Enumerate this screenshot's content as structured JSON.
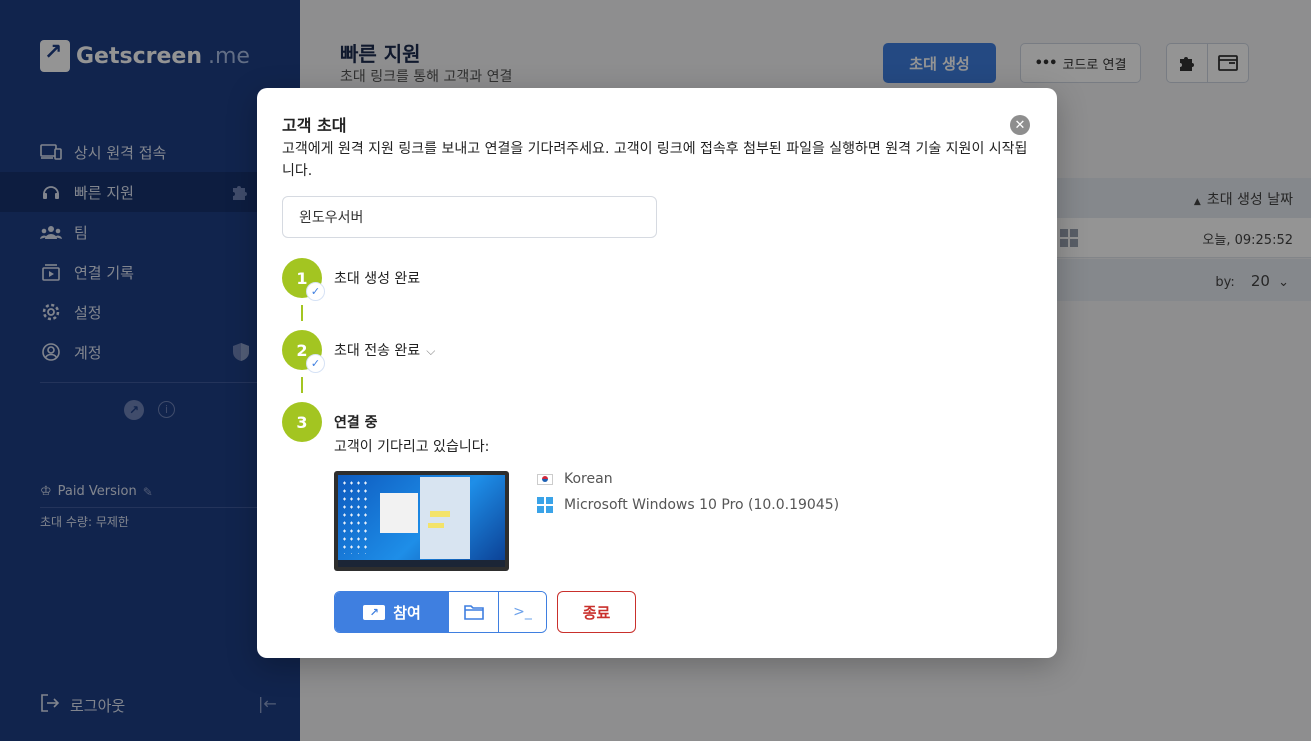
{
  "sidebar": {
    "logo_text": "Getscreen",
    "logo_suffix": ".me",
    "items": [
      {
        "label": "상시 원격 접속",
        "icon": "devices-icon"
      },
      {
        "label": "빠른 지원",
        "icon": "headset-icon",
        "active": true,
        "extra_icon": "puzzle-icon"
      },
      {
        "label": "팀",
        "icon": "team-icon"
      },
      {
        "label": "연결 기록",
        "icon": "history-icon"
      },
      {
        "label": "설정",
        "icon": "gear-icon"
      },
      {
        "label": "계정",
        "icon": "account-icon",
        "extra_icon": "shield-icon"
      }
    ],
    "paid_version": "Paid Version",
    "invite_count": "초대 수량: 무제한",
    "logout": "로그아웃"
  },
  "main": {
    "title": "빠른 지원",
    "subtitle": "초대 링크를 통해 고객과 연결",
    "create_button": "초대 생성",
    "code_connect_button": "코드로 연결",
    "code_dots": "•••",
    "table": {
      "sort_header": "초대 생성 날짜",
      "row_time": "오늘, 09:25:52",
      "per_page_label": "by:",
      "per_page_value": "20"
    }
  },
  "modal": {
    "title": "고객 초대",
    "description": "고객에게 원격 지원 링크를 보내고 연결을 기다려주세요. 고객이 링크에 접속후 첨부된 파일을 실행하면 원격 기술 지원이 시작됩니다.",
    "name_value": "윈도우서버",
    "steps": [
      {
        "number": "1",
        "label": "초대 생성 완료",
        "done": true
      },
      {
        "number": "2",
        "label": "초대 전송 완료",
        "done": true
      },
      {
        "number": "3",
        "label": "연결 중",
        "done": false
      }
    ],
    "waiting_text": "고객이 기다리고 있습니다:",
    "language": "Korean",
    "os": "Microsoft Windows 10 Pro (10.0.19045)",
    "join_button": "참여",
    "end_button": "종료",
    "terminal_glyph": ">_"
  },
  "colors": {
    "sidebar": "#1e3e86",
    "accent": "#3f7fe0",
    "step": "#a3c521",
    "danger": "#c9302c"
  }
}
